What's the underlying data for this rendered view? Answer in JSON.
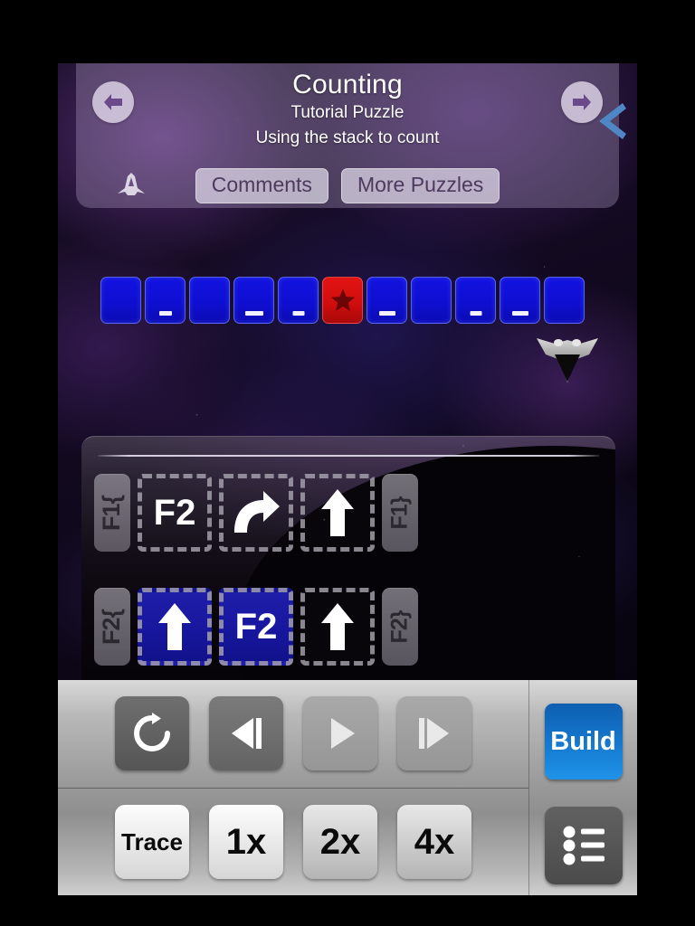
{
  "header": {
    "title": "Counting",
    "subtitle": "Tutorial Puzzle",
    "description": "Using the stack to count",
    "prev_icon": "arrow-left-icon",
    "next_icon": "arrow-right-icon",
    "ship_icon": "spaceship-icon",
    "edge_arrow_icon": "arrow-left-icon",
    "buttons": [
      {
        "label": "Comments",
        "name": "comments-button"
      },
      {
        "label": "More Puzzles",
        "name": "more-puzzles-button"
      }
    ]
  },
  "board": {
    "tiles": [
      {
        "color": "blue",
        "mark": "none"
      },
      {
        "color": "blue",
        "mark": "dash",
        "dash_width": 14
      },
      {
        "color": "blue",
        "mark": "none"
      },
      {
        "color": "blue",
        "mark": "dash",
        "dash_width": 20
      },
      {
        "color": "blue",
        "mark": "dash",
        "dash_width": 13
      },
      {
        "color": "red",
        "mark": "star"
      },
      {
        "color": "blue",
        "mark": "dash",
        "dash_width": 18
      },
      {
        "color": "blue",
        "mark": "none"
      },
      {
        "color": "blue",
        "mark": "dash",
        "dash_width": 13
      },
      {
        "color": "blue",
        "mark": "dash",
        "dash_width": 18
      },
      {
        "color": "blue",
        "mark": "none"
      }
    ],
    "robot": {
      "name": "player-ship",
      "facing": "down",
      "tile_index": 10
    },
    "colors": {
      "blue": "#0f0fd2",
      "red": "#cf0d0d",
      "star": "#6b0606"
    }
  },
  "editor": {
    "functions": [
      {
        "name": "F1",
        "open_label": "F1{",
        "close_label": "F1}",
        "slots": [
          {
            "type": "call",
            "label": "F2",
            "fill": "none"
          },
          {
            "type": "turn-right",
            "label": "",
            "fill": "none"
          },
          {
            "type": "forward",
            "label": "",
            "fill": "none"
          }
        ]
      },
      {
        "name": "F2",
        "open_label": "F2{",
        "close_label": "F2}",
        "slots": [
          {
            "type": "forward",
            "label": "",
            "fill": "blue"
          },
          {
            "type": "call",
            "label": "F2",
            "fill": "blue"
          },
          {
            "type": "forward",
            "label": "",
            "fill": "none"
          }
        ]
      }
    ]
  },
  "toolbar": {
    "playback": [
      {
        "name": "reset-button",
        "icon": "reset-circular-arrow-icon",
        "state": "dark"
      },
      {
        "name": "step-back-button",
        "icon": "step-back-icon",
        "state": "mid"
      },
      {
        "name": "play-button",
        "icon": "play-icon",
        "state": "dim"
      },
      {
        "name": "step-forward-button",
        "icon": "step-forward-icon",
        "state": "dim"
      }
    ],
    "speeds": [
      {
        "name": "trace-button",
        "label": "Trace",
        "style": "bright"
      },
      {
        "name": "speed-1x-button",
        "label": "1x",
        "style": "bright"
      },
      {
        "name": "speed-2x-button",
        "label": "2x",
        "style": "grey"
      },
      {
        "name": "speed-4x-button",
        "label": "4x",
        "style": "grey"
      }
    ],
    "build_label": "Build",
    "build_color": "#1272c8",
    "list_icon": "list-menu-icon"
  }
}
